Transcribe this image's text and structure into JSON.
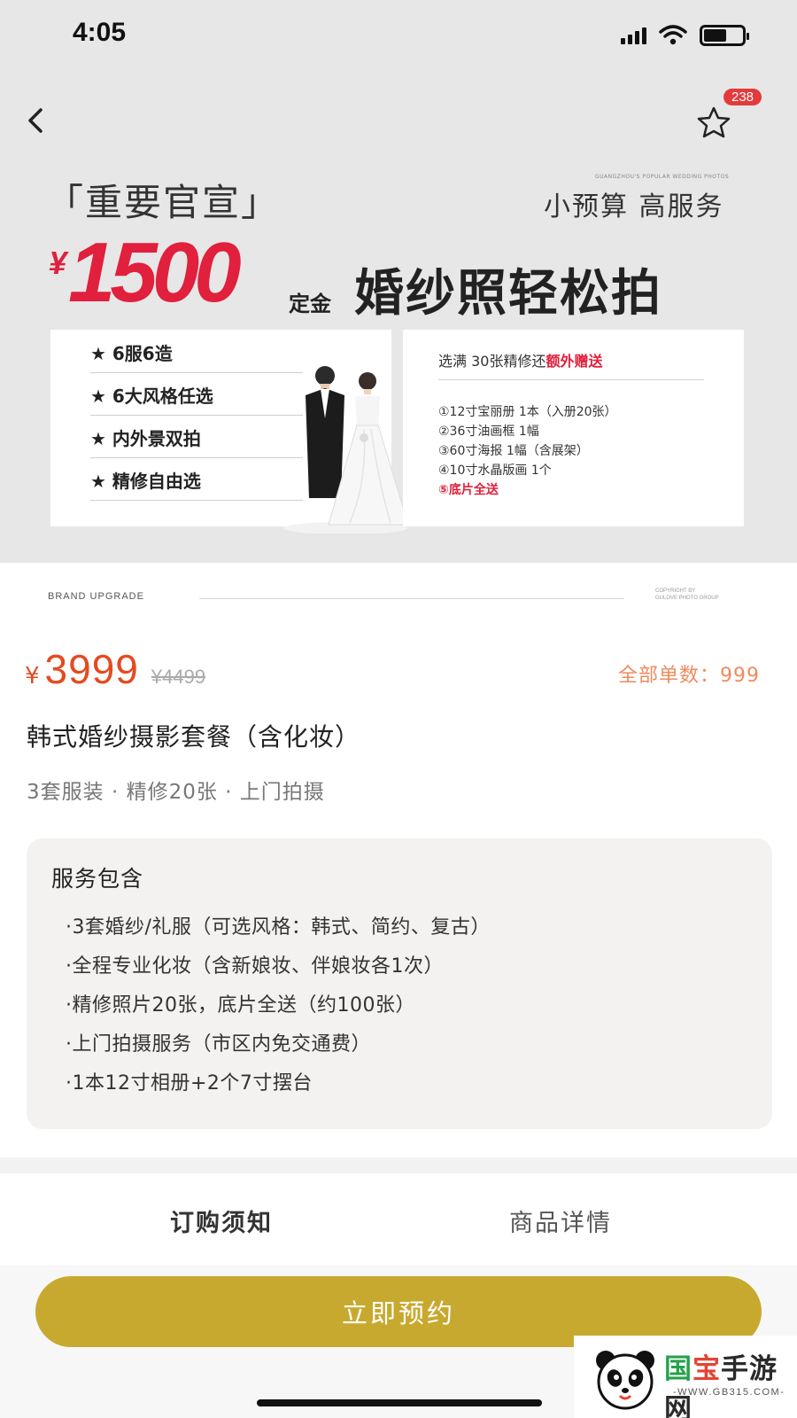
{
  "status_bar": {
    "time": "4:05"
  },
  "header": {
    "favorite_count": "238"
  },
  "banner": {
    "headline": "「重要官宣」",
    "tiny_caption": "GUANGZHOU'S POPULAR WEDDING PHOTOS",
    "slogan": "小预算 高服务",
    "price_currency": "¥",
    "price_value": "1500",
    "deposit_label": "定金",
    "main_title": "婚纱照轻松拍",
    "features": [
      "★ 6服6造",
      "★ 6大风格任选",
      "★ 内外景双拍",
      "★ 精修自由选"
    ],
    "gift_heading_prefix": "选满 30张精修还",
    "gift_heading_highlight": "额外赠送",
    "gift_items": [
      "①12寸宝丽册 1本（入册20张）",
      "②36寸油画框 1幅",
      "③60寸海报 1幅（含展架）",
      "④10寸水晶版画 1个",
      "⑤底片全送"
    ]
  },
  "brand_strip": {
    "left": "BRAND   UPGRADE",
    "right_line1": "COPYRIGHT BY",
    "right_line2": "GULOVE PHOTO GROUP"
  },
  "product": {
    "currency": "¥",
    "price": "3999",
    "original_price": "¥4499",
    "sales": "全部单数：999",
    "title": "韩式婚纱摄影套餐（含化妆）",
    "subtitle": "3套服装 · 精修20张 · 上门拍摄"
  },
  "services": {
    "title": "服务包含",
    "items": [
      "·3套婚纱/礼服（可选风格：韩式、简约、复古）",
      "·全程专业化妆（含新娘妆、伴娘妆各1次）",
      "·精修照片20张，底片全送（约100张）",
      "·上门拍摄服务（市区内免交通费）",
      "·1本12寸相册+2个7寸摆台"
    ]
  },
  "tabs": {
    "order": "订购须知",
    "detail": "商品详情"
  },
  "cta": {
    "book_label": "立即预约"
  },
  "watermark": {
    "name_part1": "国",
    "name_part2": "宝",
    "name_part3": "手游网",
    "url": "-WWW.GB315.COM-"
  },
  "colors": {
    "accent_price": "#e44a20",
    "banner_red": "#e0203c",
    "cta_gold": "#c8a92f",
    "badge_red": "#e33b3b"
  }
}
